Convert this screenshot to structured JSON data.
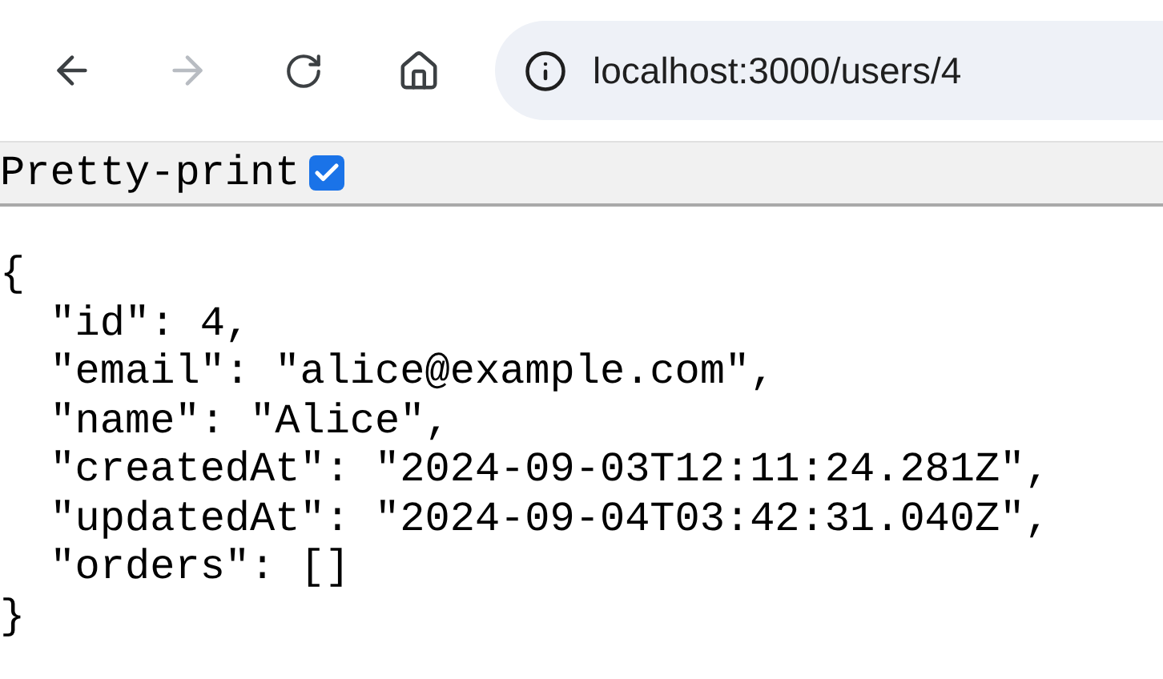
{
  "toolbar": {
    "back": {
      "disabled": false
    },
    "forward": {
      "disabled": true
    },
    "url": "localhost:3000/users/4"
  },
  "pretty_print": {
    "label": "Pretty-print",
    "checked": true
  },
  "json_lines": [
    "{",
    "  \"id\": 4,",
    "  \"email\": \"alice@example.com\",",
    "  \"name\": \"Alice\",",
    "  \"createdAt\": \"2024-09-03T12:11:24.281Z\",",
    "  \"updatedAt\": \"2024-09-04T03:42:31.040Z\",",
    "  \"orders\": []",
    "}"
  ]
}
